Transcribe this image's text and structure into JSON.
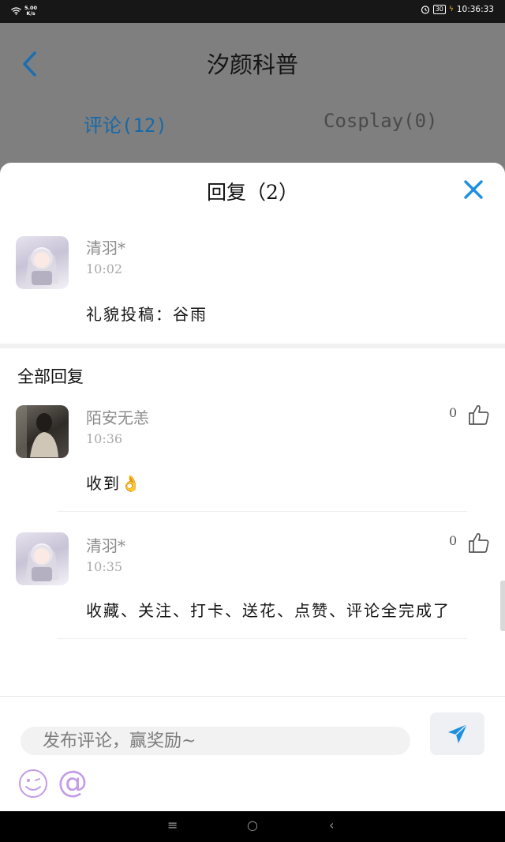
{
  "status_bar": {
    "net_speed_value": "5.00",
    "net_speed_unit": "K/s",
    "battery": "30",
    "time": "10:36:33",
    "icons": [
      "wifi-icon",
      "alarm-icon",
      "battery-icon",
      "charging-icon"
    ]
  },
  "header": {
    "title": "汐颜科普",
    "back_icon": "chevron-left-icon",
    "tabs": [
      {
        "label": "评论(12)",
        "active": true
      },
      {
        "label": "Cosplay(0)",
        "active": false
      }
    ]
  },
  "sheet": {
    "title": "回复（2）",
    "close_icon": "close-icon",
    "original_comment": {
      "author": "清羽*",
      "time": "10:02",
      "text": "礼貌投稿：谷雨"
    },
    "replies_heading": "全部回复",
    "replies": [
      {
        "author": "陌安无恙",
        "time": "10:36",
        "text": "收到👌",
        "likes": "0"
      },
      {
        "author": "清羽*",
        "time": "10:35",
        "text": "收藏、关注、打卡、送花、点赞、评论全完成了",
        "likes": "0"
      }
    ]
  },
  "composer": {
    "placeholder": "发布评论，赢奖励~",
    "mention_symbol": "@",
    "send_icon": "send-icon",
    "emoji_icon": "emoji-icon"
  },
  "nav_bar": {
    "menu": "≡",
    "home": "○",
    "back": "‹"
  },
  "colors": {
    "accent": "#1d8fe0",
    "active_tab": "#1769a8",
    "emoji_purple": "#c39be6"
  }
}
